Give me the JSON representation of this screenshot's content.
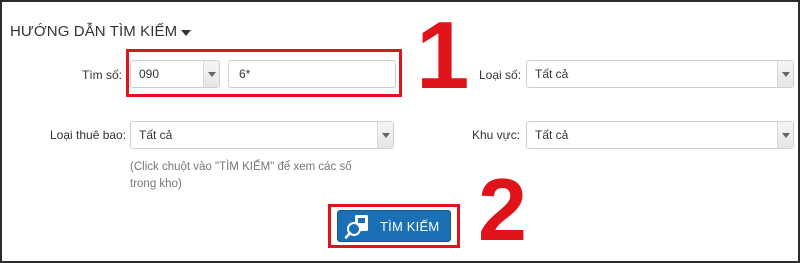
{
  "header": {
    "title": "HƯỚNG DẪN TÌM KIẾM"
  },
  "search": {
    "label": "Tìm số:",
    "prefix_value": "090",
    "pattern_value": "6*"
  },
  "number_type": {
    "label": "Loại số:",
    "value": "Tất cả"
  },
  "subscription_type": {
    "label": "Loại thuê bao:",
    "value": "Tất cả"
  },
  "region": {
    "label": "Khu vực:",
    "value": "Tất cả"
  },
  "hint": {
    "text": "(Click chuột vào \"TÌM KIẾM\" để xem các số trong kho)"
  },
  "search_button": {
    "label": "TÌM KIẾM"
  },
  "annotations": {
    "step1": "1",
    "step2": "2"
  },
  "colors": {
    "accent_red": "#e0121a",
    "button_blue": "#1a6fb5"
  }
}
